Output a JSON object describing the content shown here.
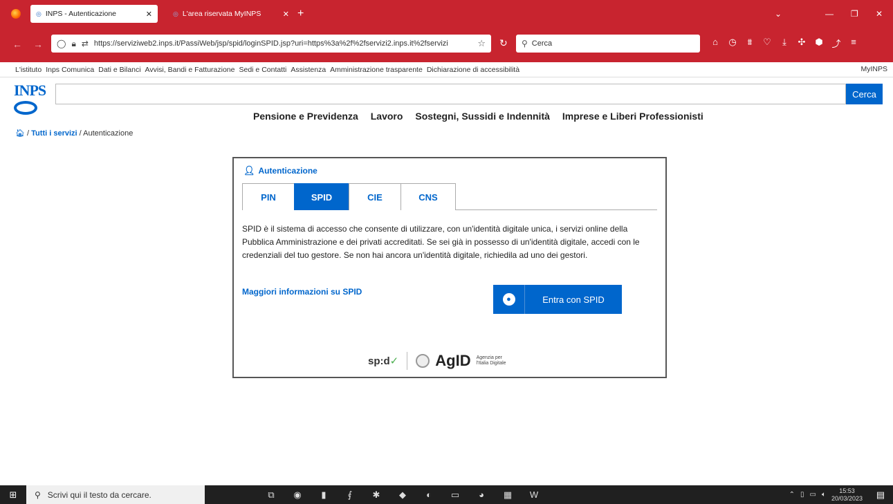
{
  "browser": {
    "tabs": [
      {
        "label": "INPS - Autenticazione",
        "active": true
      },
      {
        "label": "L'area riservata MyINPS",
        "active": false
      }
    ],
    "new_tab": "+",
    "url": "https://serviziweb2.inps.it/PassiWeb/jsp/spid/loginSPID.jsp?uri=https%3a%2f%2fservizi2.inps.it%2fservizi",
    "search_placeholder": "Cerca"
  },
  "topmenu": {
    "items": [
      "L'istituto",
      "Inps Comunica",
      "Dati e Bilanci",
      "Avvisi, Bandi e Fatturazione",
      "Sedi e Contatti",
      "Assistenza",
      "Amministrazione trasparente",
      "Dichiarazione di accessibilità"
    ],
    "myinps": "MyINPS"
  },
  "logo_text": "INPS",
  "site_search": {
    "button": "Cerca",
    "value": ""
  },
  "mainnav": [
    "Pensione e Previdenza",
    "Lavoro",
    "Sostegni, Sussidi e Indennità",
    "Imprese e Liberi Professionisti"
  ],
  "breadcrumb": {
    "sep": "/",
    "link": "Tutti i servizi",
    "current": "Autenticazione"
  },
  "auth": {
    "title": "Autenticazione",
    "tabs": [
      "PIN",
      "SPID",
      "CIE",
      "CNS"
    ],
    "selected_tab": "SPID",
    "description": "SPID è il sistema di accesso che consente di utilizzare, con un'identità digitale unica, i servizi online della Pubblica Amministrazione e dei privati accreditati. Se sei già in possesso di un'identità digitale, accedi con le credenziali del tuo gestore. Se non hai ancora un'identità digitale, richiedila ad uno dei gestori.",
    "more_link": "Maggiori informazioni su SPID",
    "spid_button": "Entra con SPID",
    "spid_logo": "sp:d",
    "agid": "AgID",
    "agid_sub": "Agenzia per l'Italia Digitale"
  },
  "taskbar": {
    "search_placeholder": "Scrivi qui il testo da cercare.",
    "time": "15:53",
    "date": "20/03/2023"
  },
  "colors": {
    "browser_red": "#c8242f",
    "inps_blue": "#0066cc"
  }
}
